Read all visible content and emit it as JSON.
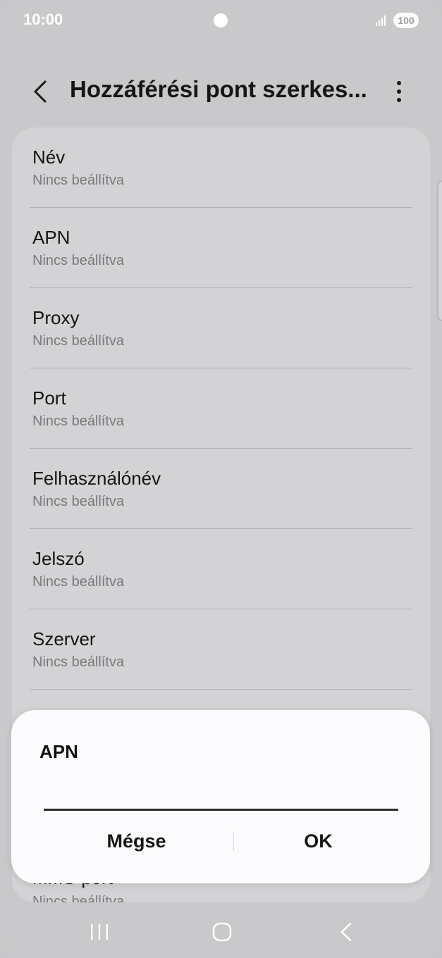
{
  "status": {
    "time": "10:00",
    "battery": "100"
  },
  "header": {
    "title": "Hozzáférési pont szerkes..."
  },
  "settings": [
    {
      "title": "Név",
      "value": "Nincs beállítva"
    },
    {
      "title": "APN",
      "value": "Nincs beállítva"
    },
    {
      "title": "Proxy",
      "value": "Nincs beállítva"
    },
    {
      "title": "Port",
      "value": "Nincs beállítva"
    },
    {
      "title": "Felhasználónév",
      "value": "Nincs beállítva"
    },
    {
      "title": "Jelszó",
      "value": "Nincs beállítva"
    },
    {
      "title": "Szerver",
      "value": "Nincs beállítva"
    },
    {
      "title": "MMS-port",
      "value": "Nincs beállítva"
    }
  ],
  "dialog": {
    "title": "APN",
    "input_value": "",
    "cancel_label": "Mégse",
    "ok_label": "OK"
  },
  "icons": {
    "back": "chevron-left-icon",
    "more": "more-vertical-icon",
    "signal": "signal-icon",
    "nav_recent": "recent-apps-icon",
    "nav_home": "home-icon",
    "nav_back": "nav-back-icon"
  }
}
